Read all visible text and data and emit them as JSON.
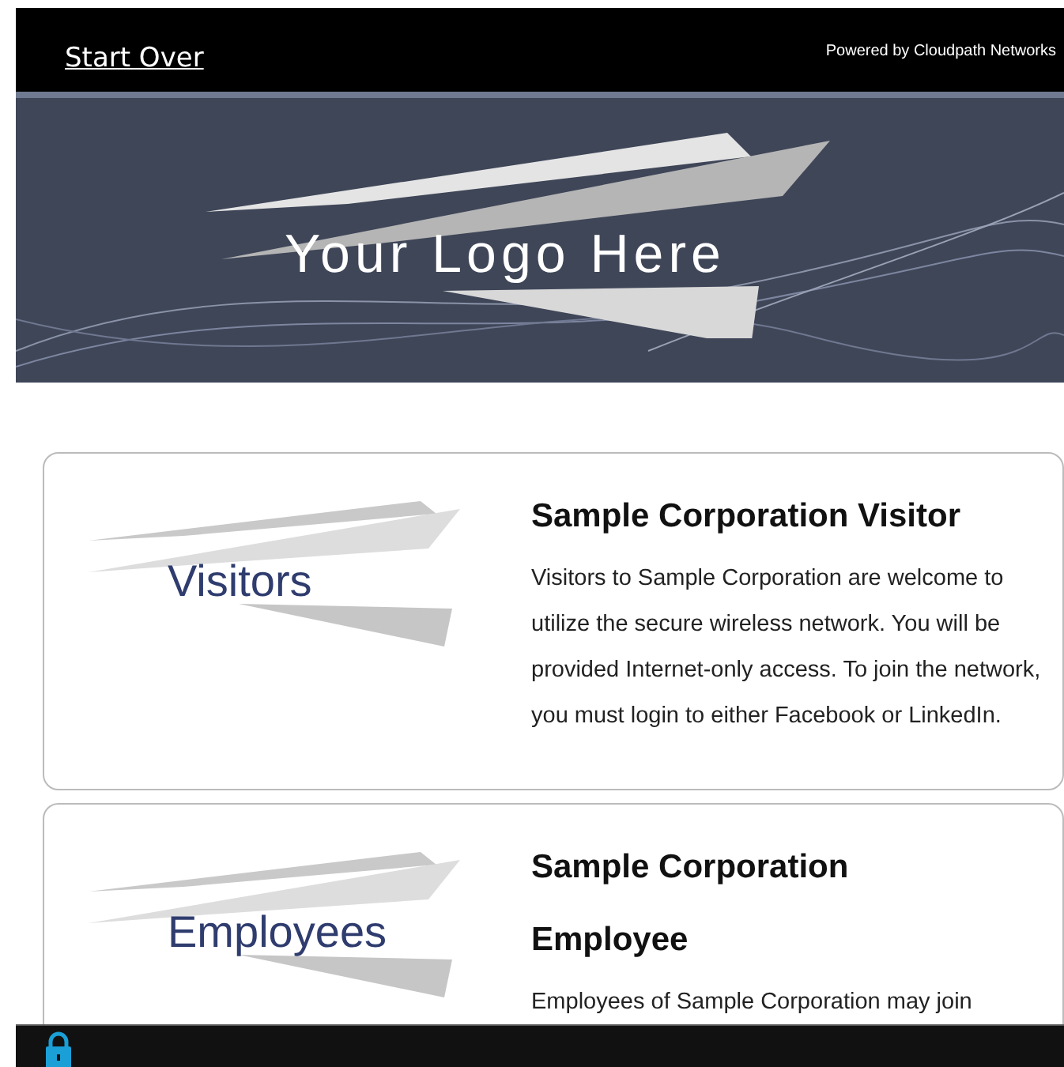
{
  "header": {
    "start_over": "Start Over",
    "powered_by": "Powered by Cloudpath Networks"
  },
  "banner": {
    "logo_text": "Your Logo Here"
  },
  "options": [
    {
      "logo_text": "Visitors",
      "title": "Sample Corporation Visitor",
      "description": "Visitors to Sample Corporation are welcome to utilize the secure wireless network. You will be provided Internet-only access. To join the network, you must login to either Facebook or LinkedIn."
    },
    {
      "logo_text": "Employees",
      "title": "Sample Corporation Employee",
      "description": "Employees of Sample Corporation may join"
    }
  ]
}
